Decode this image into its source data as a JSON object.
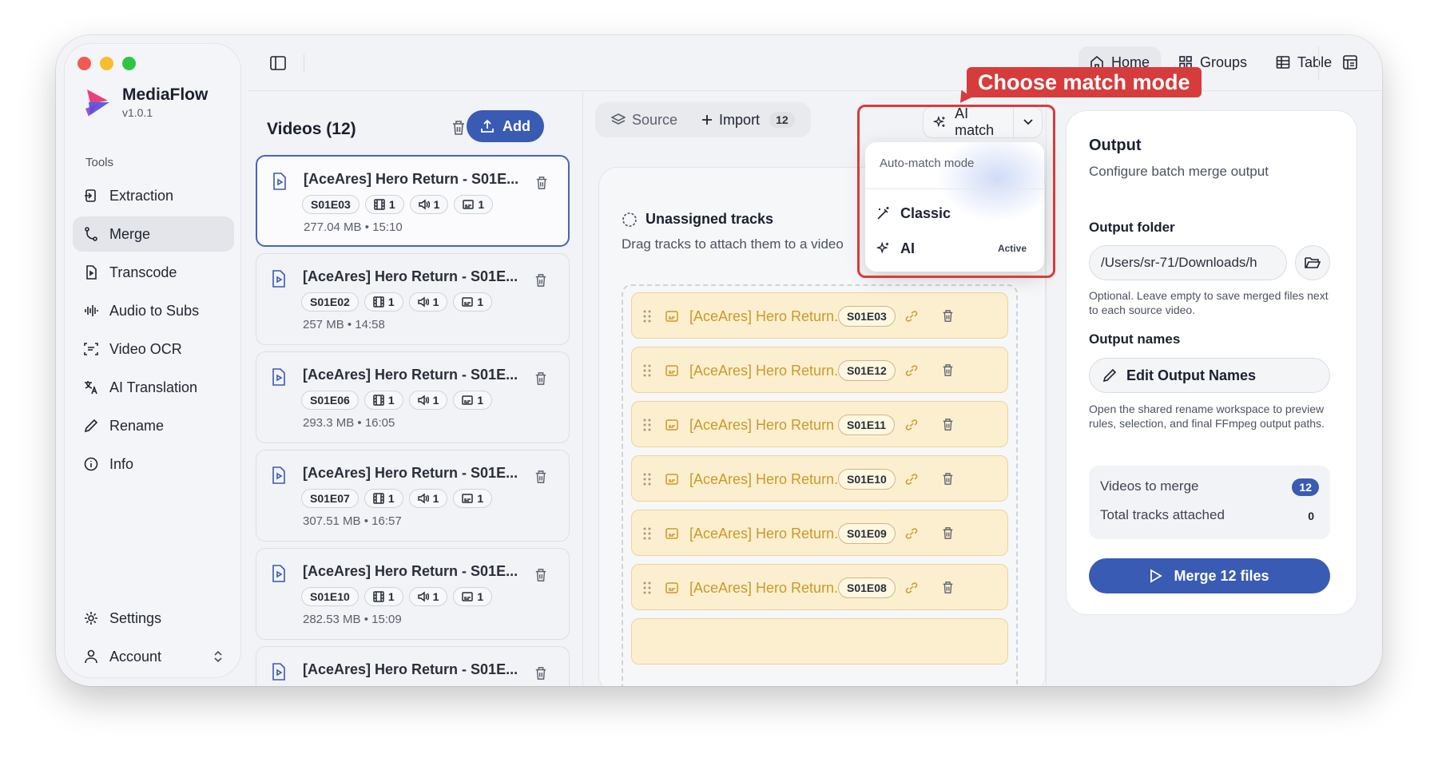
{
  "app": {
    "name": "MediaFlow",
    "version": "v1.0.1"
  },
  "sidebar": {
    "section_label": "Tools",
    "items": [
      {
        "label": "Extraction",
        "icon": "extraction-icon"
      },
      {
        "label": "Merge",
        "icon": "merge-icon",
        "active": true
      },
      {
        "label": "Transcode",
        "icon": "transcode-icon"
      },
      {
        "label": "Audio to Subs",
        "icon": "audio-wave-icon"
      },
      {
        "label": "Video OCR",
        "icon": "ocr-scan-icon"
      },
      {
        "label": "AI Translation",
        "icon": "translate-icon"
      },
      {
        "label": "Rename",
        "icon": "pencil-icon"
      },
      {
        "label": "Info",
        "icon": "info-icon"
      }
    ],
    "bottom": [
      {
        "label": "Settings",
        "icon": "gear-icon"
      },
      {
        "label": "Account",
        "icon": "user-icon"
      }
    ]
  },
  "topnav": {
    "home": "Home",
    "groups": "Groups",
    "table": "Table"
  },
  "videos": {
    "title": "Videos (12)",
    "add_label": "Add",
    "items": [
      {
        "title": "[AceAres] Hero Return - S01E...",
        "episode": "S01E03",
        "video": "1",
        "audio": "1",
        "subs": "1",
        "size": "277.04 MB",
        "duration": "15:10",
        "selected": true
      },
      {
        "title": "[AceAres] Hero Return - S01E...",
        "episode": "S01E02",
        "video": "1",
        "audio": "1",
        "subs": "1",
        "size": "257 MB",
        "duration": "14:58"
      },
      {
        "title": "[AceAres] Hero Return - S01E...",
        "episode": "S01E06",
        "video": "1",
        "audio": "1",
        "subs": "1",
        "size": "293.3 MB",
        "duration": "16:05"
      },
      {
        "title": "[AceAres] Hero Return - S01E...",
        "episode": "S01E07",
        "video": "1",
        "audio": "1",
        "subs": "1",
        "size": "307.51 MB",
        "duration": "16:57"
      },
      {
        "title": "[AceAres] Hero Return - S01E...",
        "episode": "S01E10",
        "video": "1",
        "audio": "1",
        "subs": "1",
        "size": "282.53 MB",
        "duration": "15:09"
      },
      {
        "title": "[AceAres] Hero Return - S01E...",
        "episode": "",
        "video": "",
        "audio": "",
        "subs": "",
        "size": "",
        "duration": ""
      }
    ]
  },
  "tracks_toolbar": {
    "source_label": "Source",
    "import_label": "Import",
    "import_count": "12"
  },
  "match": {
    "button_label": "AI match",
    "menu_header": "Auto-match mode",
    "options": [
      {
        "label": "Classic"
      },
      {
        "label": "AI",
        "status": "Active"
      }
    ]
  },
  "unassigned": {
    "title": "Unassigned tracks",
    "subtitle": "Drag tracks to attach them to a video",
    "tracks": [
      {
        "title": "[AceAres] Hero Return...",
        "episode": "S01E03"
      },
      {
        "title": "[AceAres] Hero Return...",
        "episode": "S01E12"
      },
      {
        "title": "[AceAres] Hero Return ...",
        "episode": "S01E11"
      },
      {
        "title": "[AceAres] Hero Return...",
        "episode": "S01E10"
      },
      {
        "title": "[AceAres] Hero Return...",
        "episode": "S01E09"
      },
      {
        "title": "[AceAres] Hero Return...",
        "episode": "S01E08"
      }
    ]
  },
  "output": {
    "title": "Output",
    "subtitle": "Configure batch merge output",
    "folder_label": "Output folder",
    "folder_value": "/Users/sr-71/Downloads/h",
    "folder_hint": "Optional. Leave empty to save merged files next to each source video.",
    "names_label": "Output names",
    "edit_names_label": "Edit Output Names",
    "names_hint": "Open the shared rename workspace to preview rules, selection, and final FFmpeg output paths.",
    "videos_to_merge_label": "Videos to merge",
    "videos_to_merge_value": "12",
    "tracks_attached_label": "Total tracks attached",
    "tracks_attached_value": "0",
    "merge_button_label": "Merge 12 files"
  },
  "annotation": {
    "callout": "Choose match mode",
    "color": "#d63c3c"
  },
  "colors": {
    "accent": "#3a5bb3",
    "track_bg": "#fcefcf",
    "track_text": "#c99a2a"
  }
}
